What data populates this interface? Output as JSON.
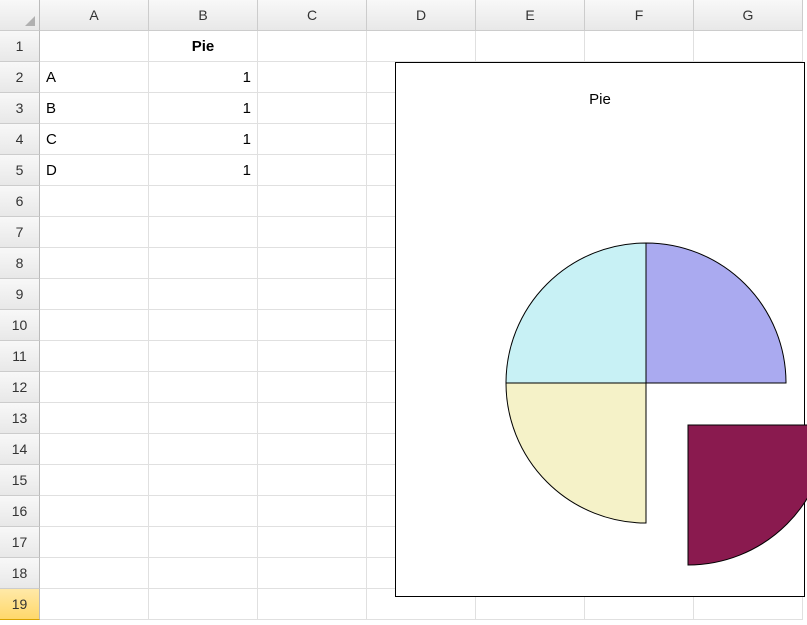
{
  "columns": [
    "A",
    "B",
    "C",
    "D",
    "E",
    "F",
    "G"
  ],
  "rows": [
    "1",
    "2",
    "3",
    "4",
    "5",
    "6",
    "7",
    "8",
    "9",
    "10",
    "11",
    "12",
    "13",
    "14",
    "15",
    "16",
    "17",
    "18",
    "19"
  ],
  "selected_row": "19",
  "cells": {
    "B1": "Pie",
    "A2": "A",
    "B2": "1",
    "A3": "B",
    "B3": "1",
    "A4": "C",
    "B4": "1",
    "A5": "D",
    "B5": "1"
  },
  "chart_data": {
    "type": "pie",
    "title": "Pie",
    "categories": [
      "A",
      "B",
      "C",
      "D"
    ],
    "values": [
      1,
      1,
      1,
      1
    ],
    "exploded_slice": "D",
    "colors": {
      "A": "#aaaaf0",
      "B": "#8a1a4f",
      "C": "#f5f2c8",
      "D": "#c8f1f5"
    }
  }
}
